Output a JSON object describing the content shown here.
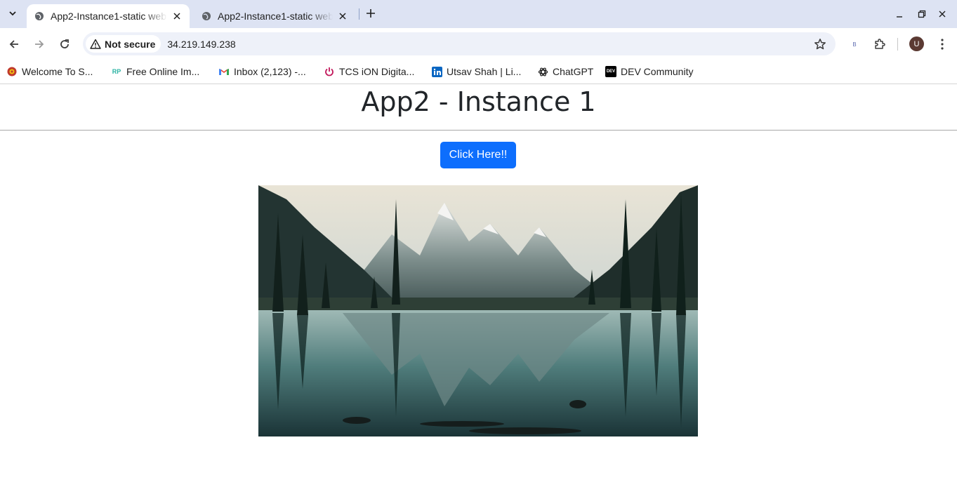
{
  "browser": {
    "tabs": [
      {
        "title": "App2-Instance1-static website",
        "active": true
      },
      {
        "title": "App2-Instance1-static website",
        "active": false
      }
    ],
    "security_label": "Not secure",
    "url": "34.219.149.238",
    "extension_badge": "B",
    "profile_initial": "U"
  },
  "bookmarks": [
    {
      "label": "Welcome To S...",
      "icon": "crest-icon"
    },
    {
      "label": "Free Online Im...",
      "icon": "rp-logo-icon",
      "icon_text": "RP"
    },
    {
      "label": "Inbox (2,123) -...",
      "icon": "gmail-icon"
    },
    {
      "label": "TCS iON Digita...",
      "icon": "power-icon"
    },
    {
      "label": "Utsav Shah | Li...",
      "icon": "linkedin-icon"
    },
    {
      "label": "ChatGPT",
      "icon": "openai-icon"
    },
    {
      "label": "DEV Community",
      "icon": "dev-logo-icon",
      "icon_text": "DEV"
    }
  ],
  "page": {
    "heading": "App2 - Instance 1",
    "button_label": "Click Here!!",
    "image_icon": "mountain-lake-image"
  },
  "colors": {
    "tabstrip": "#dde3f3",
    "omnibox": "#eef1f9",
    "primary_button": "#0d6efd",
    "heading_text": "#212529"
  }
}
